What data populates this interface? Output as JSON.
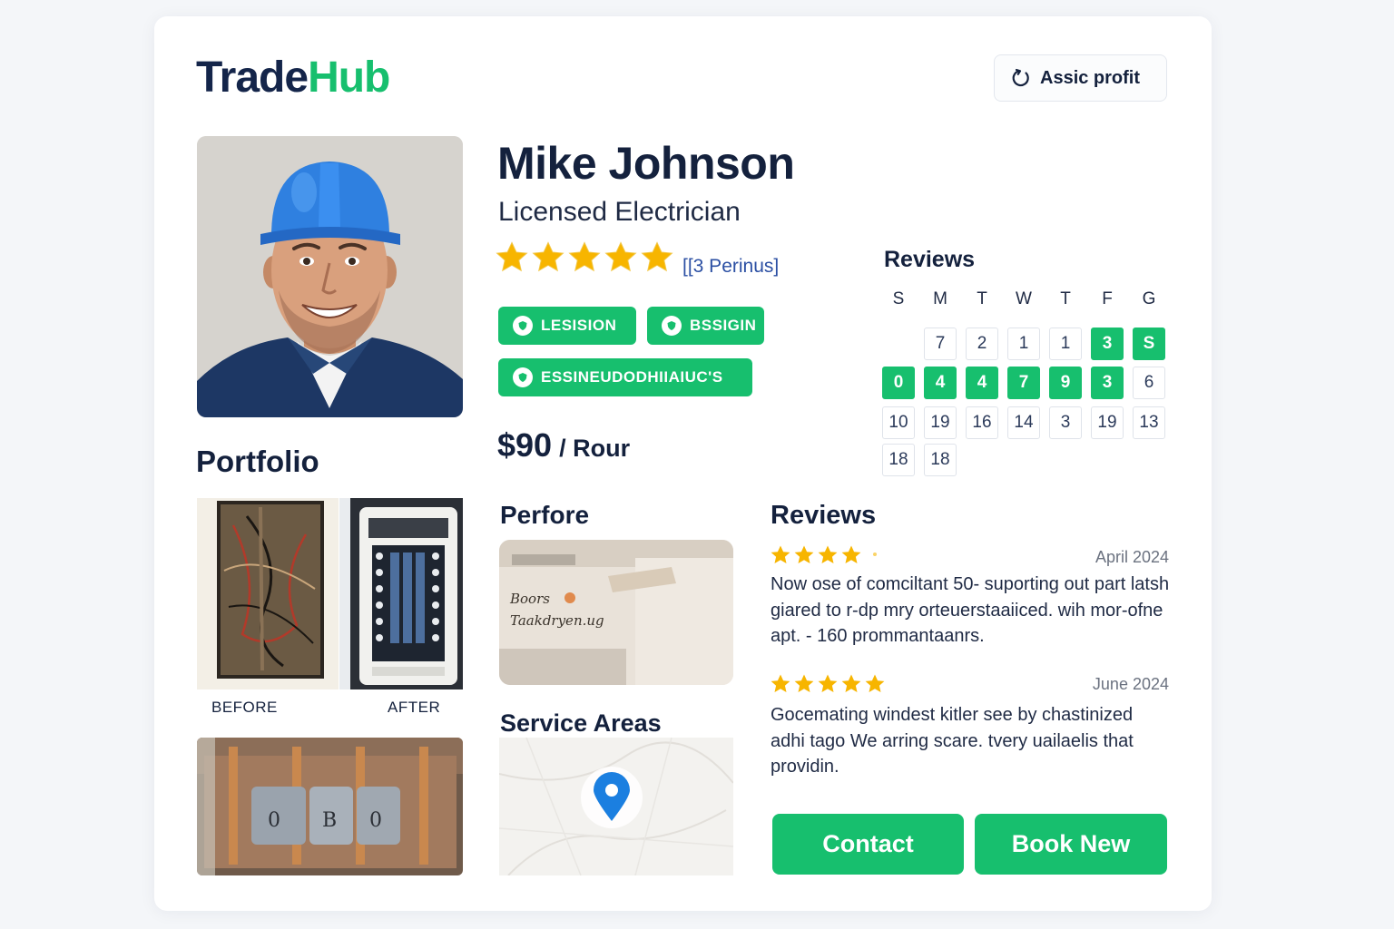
{
  "brand": {
    "part1": "Trade",
    "part2": "Hub"
  },
  "header": {
    "action_label": "Assic profit"
  },
  "profile": {
    "name": "Mike Johnson",
    "title": "Licensed Electrician",
    "rating": 5,
    "rating_count_label": "[[3 Perinus]",
    "badges": [
      "LESISION",
      "BSSIGIN",
      "ESSINEUDODHIIAIUC'S"
    ],
    "price": "$90",
    "price_unit": "/ Rour"
  },
  "calendar": {
    "heading": "Reviews",
    "weekdays": [
      "S",
      "M",
      "T",
      "W",
      "T",
      "F",
      "G"
    ],
    "rows": [
      [
        null,
        {
          "d": "7",
          "on": false
        },
        {
          "d": "2",
          "on": false
        },
        {
          "d": "1",
          "on": false
        },
        {
          "d": "1",
          "on": false
        },
        {
          "d": "3",
          "on": true
        },
        {
          "d": "S",
          "on": true
        }
      ],
      [
        {
          "d": "0",
          "on": true
        },
        {
          "d": "4",
          "on": true
        },
        {
          "d": "4",
          "on": true
        },
        {
          "d": "7",
          "on": true
        },
        {
          "d": "9",
          "on": true
        },
        {
          "d": "3",
          "on": true
        },
        {
          "d": "6",
          "on": false
        }
      ],
      [
        {
          "d": "10",
          "on": false
        },
        {
          "d": "19",
          "on": false
        },
        {
          "d": "16",
          "on": false
        },
        {
          "d": "14",
          "on": false
        },
        {
          "d": "3",
          "on": false
        },
        {
          "d": "19",
          "on": false
        },
        {
          "d": "13",
          "on": false
        }
      ],
      [
        {
          "d": "18",
          "on": false
        },
        {
          "d": "18",
          "on": false
        },
        null,
        null,
        null,
        null,
        null
      ]
    ]
  },
  "portfolio": {
    "heading": "Portfolio",
    "before_label": "BEFORE",
    "after_label": "AFTER"
  },
  "perfore": {
    "heading": "Perfore",
    "sign_line1": "Boors",
    "sign_line2": "Taakdryen.ug"
  },
  "service_areas": {
    "heading": "Service Areas"
  },
  "reviews": {
    "heading": "Reviews",
    "items": [
      {
        "stars": 4,
        "date": "April 2024",
        "text": "Now ose of comciltant 50- suporting out part latsh giared to r-dp mry orteuerstaaiiced. wih mor-ofne apt. - 160 prommantaanrs."
      },
      {
        "stars": 5,
        "date": "June 2024",
        "text": "Gocemating windest kitler see by chastinized adhi tago We arring scare. tvery uailaelis that providin."
      }
    ]
  },
  "actions": {
    "contact_label": "Contact",
    "book_label": "Book New"
  },
  "colors": {
    "brand_green": "#17bf6e",
    "navy": "#14213d",
    "star": "#f7b500"
  }
}
